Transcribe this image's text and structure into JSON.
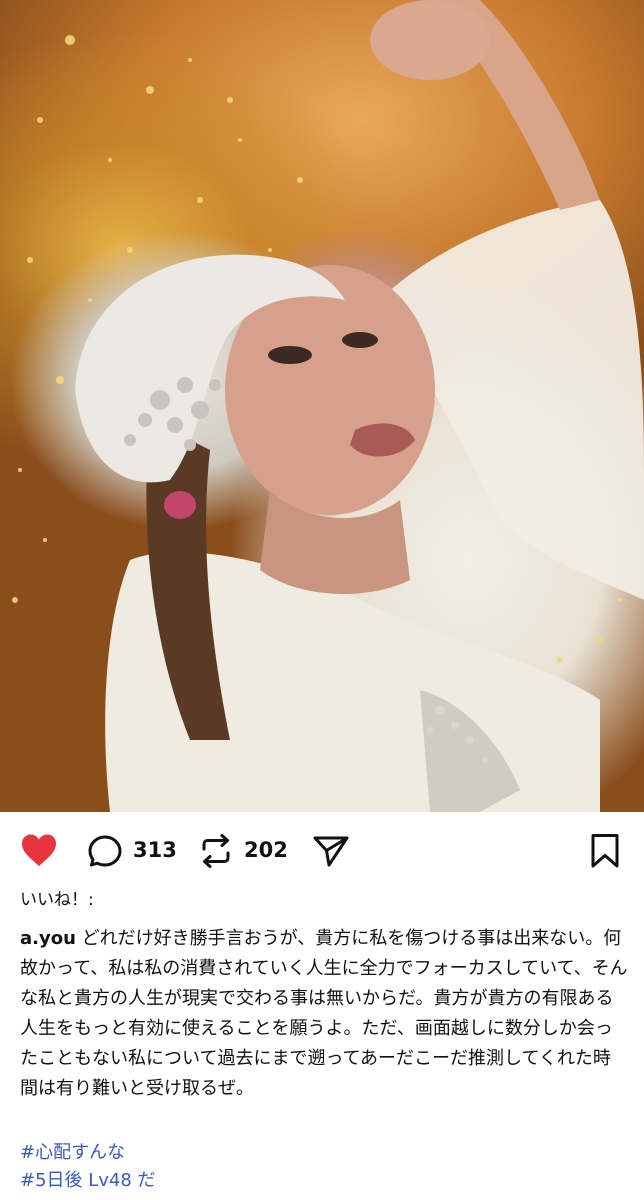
{
  "photo": {
    "description_icon": "photo-image",
    "accent_gold": "#d8a24a"
  },
  "actions": {
    "like_icon": "heart-icon",
    "comment_icon": "comment-bubble-icon",
    "comment_count": "313",
    "repost_icon": "repost-icon",
    "repost_count": "202",
    "share_icon": "send-icon",
    "save_icon": "bookmark-icon",
    "like_color": "#e8343e"
  },
  "post": {
    "likes_label": "いいね！:",
    "username": "a.you",
    "caption": "どれだけ好き勝手言おうが、貴方に私を傷つける事は出来ない。何故かって、私は私の消費されていく人生に全力でフォーカスしていて、そんな私と貴方の人生が現実で交わる事は無いからだ。貴方が貴方の有限ある人生をもっと有効に使えることを願うよ。ただ、画面越しに数分しか会ったこともない私について過去にまで遡ってあーだこーだ推測してくれた時間は有り難いと受け取るぜ。",
    "hashtags": [
      "#心配すんな",
      "#5日後 Lv48 だ"
    ],
    "hashtag_color": "#3a5bb7"
  }
}
